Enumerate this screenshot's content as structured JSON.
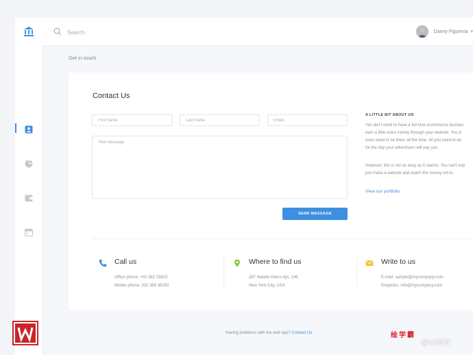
{
  "colors": {
    "accent": "#3d8fe0",
    "pin": "#8dc63f",
    "mail": "#f5c531",
    "watermark_red": "#c9252b"
  },
  "topbar": {
    "search_placeholder": "Search",
    "user_name": "Danny Figueroa",
    "avatar_icon": "avatar"
  },
  "sidebar": {
    "logo_icon": "bank-icon",
    "items": [
      {
        "icon": "contact-card-icon",
        "active": true
      },
      {
        "icon": "pie-chart-icon",
        "active": false
      },
      {
        "icon": "wallet-icon",
        "active": false
      },
      {
        "icon": "calendar-icon",
        "active": false
      }
    ]
  },
  "breadcrumb": "Get in touch",
  "form": {
    "title": "Contact Us",
    "first_name_placeholder": "First name",
    "last_name_placeholder": "Last name",
    "email_placeholder": "Email",
    "message_placeholder": "Your message",
    "send_label": "SEND MESSAGE"
  },
  "about": {
    "heading": "A LITTLE BIT ABOUT US",
    "paragraph1": [
      "Yes don't need to have a full time ecommerce busines",
      "earn a little extra money through your website. You d",
      "even need to be there all the time. All you need to do",
      "for the day your advertisers will pay you."
    ],
    "paragraph2": [
      "However, this is not as easy as it seems. You can't exp",
      "just make a website and watch the money roll in."
    ],
    "link": "View our portfolio"
  },
  "contacts": [
    {
      "icon": "phone-icon",
      "title": "Call us",
      "lines": [
        "Office phone: +42 382 23823",
        "Mobile phone: 332 383 38292"
      ]
    },
    {
      "icon": "map-pin-icon",
      "title": "Where to find us",
      "lines": [
        "287 Natalie Glens Apt. 146,",
        "New York City, USA"
      ]
    },
    {
      "icon": "mail-icon",
      "title": "Write to us",
      "lines": [
        "E-mail: sample@mycompany.com",
        "Enquiries: info@mycompany.com"
      ]
    }
  ],
  "footer": {
    "text": "Having problems with the web app?",
    "link": "Contact Us"
  },
  "watermark": {
    "chars": "绘学霸",
    "weibo": "@UI设计"
  }
}
